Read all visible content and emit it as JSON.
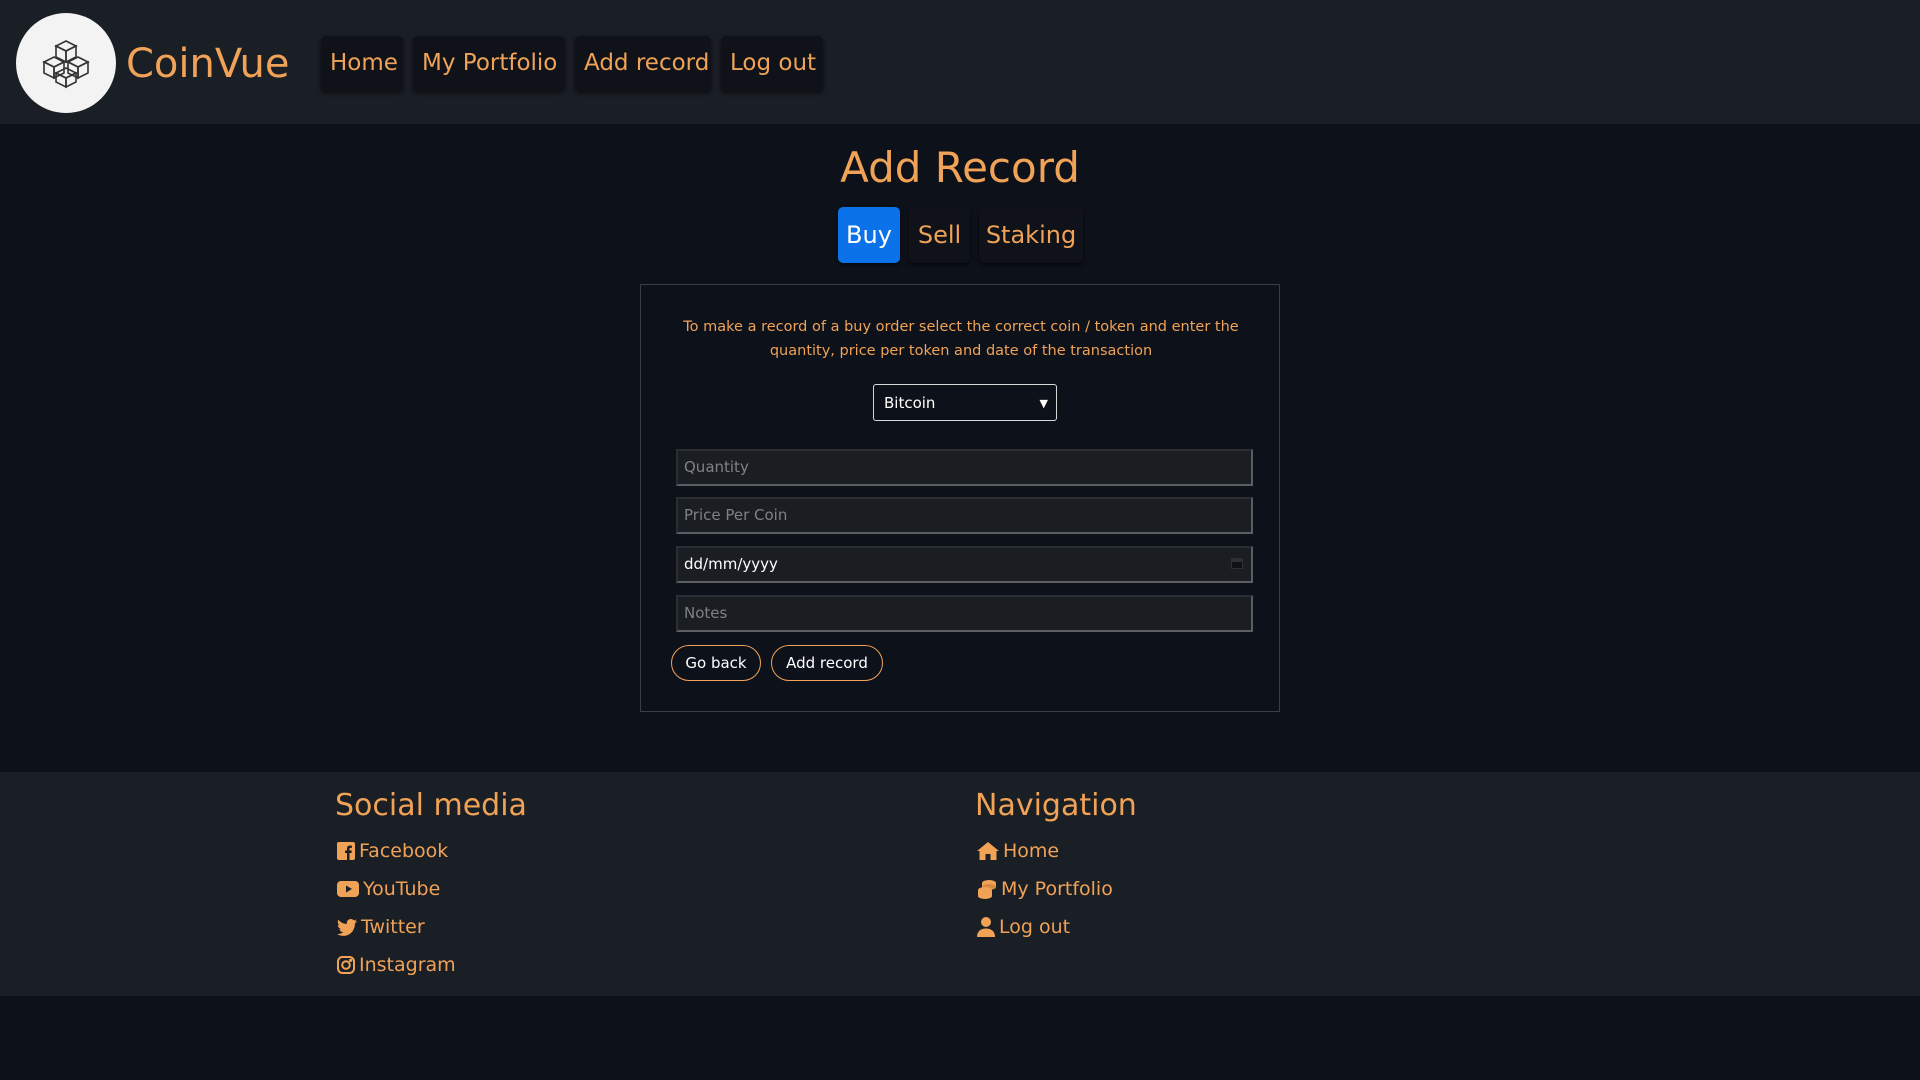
{
  "header": {
    "brand": "CoinVue",
    "nav": [
      "Home",
      "My Portfolio",
      "Add record",
      "Log out"
    ]
  },
  "page": {
    "title": "Add Record",
    "tabs": [
      "Buy",
      "Sell",
      "Staking"
    ],
    "active_tab": "Buy"
  },
  "form": {
    "instructions": "To make a record of a buy order select the correct coin / token and enter the quantity, price per token and date of the transaction",
    "coin_selected": "Bitcoin",
    "quantity_placeholder": "Quantity",
    "price_placeholder": "Price Per Coin",
    "date_placeholder": "dd/mm/yyyy",
    "notes_placeholder": "Notes",
    "go_back_label": "Go back",
    "add_label": "Add record"
  },
  "footer": {
    "social_heading": "Social media",
    "social_links": [
      "Facebook",
      "YouTube",
      "Twitter",
      "Instagram"
    ],
    "nav_heading": "Navigation",
    "nav_links": [
      "Home",
      "My Portfolio",
      "Log out"
    ]
  },
  "colors": {
    "accent": "#f0a257",
    "active_tab": "#0b72ea",
    "header_bg": "#1a1e25",
    "page_bg": "#0d111a"
  },
  "icons": {
    "logo": "cubes-logo-icon",
    "facebook": "facebook-icon",
    "youtube": "youtube-icon",
    "twitter": "twitter-icon",
    "instagram": "instagram-icon",
    "home": "home-icon",
    "portfolio": "coins-icon",
    "logout": "user-icon"
  }
}
